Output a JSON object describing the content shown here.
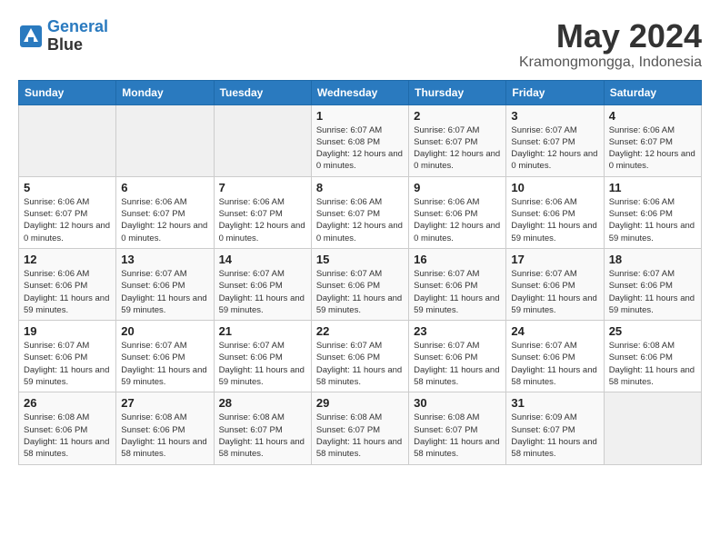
{
  "logo": {
    "line1": "General",
    "line2": "Blue"
  },
  "title": "May 2024",
  "location": "Kramongmongga, Indonesia",
  "days_of_week": [
    "Sunday",
    "Monday",
    "Tuesday",
    "Wednesday",
    "Thursday",
    "Friday",
    "Saturday"
  ],
  "weeks": [
    [
      {
        "day": "",
        "empty": true
      },
      {
        "day": "",
        "empty": true
      },
      {
        "day": "",
        "empty": true
      },
      {
        "day": "1",
        "sunrise": "6:07 AM",
        "sunset": "6:08 PM",
        "daylight": "12 hours and 0 minutes."
      },
      {
        "day": "2",
        "sunrise": "6:07 AM",
        "sunset": "6:07 PM",
        "daylight": "12 hours and 0 minutes."
      },
      {
        "day": "3",
        "sunrise": "6:07 AM",
        "sunset": "6:07 PM",
        "daylight": "12 hours and 0 minutes."
      },
      {
        "day": "4",
        "sunrise": "6:06 AM",
        "sunset": "6:07 PM",
        "daylight": "12 hours and 0 minutes."
      }
    ],
    [
      {
        "day": "5",
        "sunrise": "6:06 AM",
        "sunset": "6:07 PM",
        "daylight": "12 hours and 0 minutes."
      },
      {
        "day": "6",
        "sunrise": "6:06 AM",
        "sunset": "6:07 PM",
        "daylight": "12 hours and 0 minutes."
      },
      {
        "day": "7",
        "sunrise": "6:06 AM",
        "sunset": "6:07 PM",
        "daylight": "12 hours and 0 minutes."
      },
      {
        "day": "8",
        "sunrise": "6:06 AM",
        "sunset": "6:07 PM",
        "daylight": "12 hours and 0 minutes."
      },
      {
        "day": "9",
        "sunrise": "6:06 AM",
        "sunset": "6:06 PM",
        "daylight": "12 hours and 0 minutes."
      },
      {
        "day": "10",
        "sunrise": "6:06 AM",
        "sunset": "6:06 PM",
        "daylight": "11 hours and 59 minutes."
      },
      {
        "day": "11",
        "sunrise": "6:06 AM",
        "sunset": "6:06 PM",
        "daylight": "11 hours and 59 minutes."
      }
    ],
    [
      {
        "day": "12",
        "sunrise": "6:06 AM",
        "sunset": "6:06 PM",
        "daylight": "11 hours and 59 minutes."
      },
      {
        "day": "13",
        "sunrise": "6:07 AM",
        "sunset": "6:06 PM",
        "daylight": "11 hours and 59 minutes."
      },
      {
        "day": "14",
        "sunrise": "6:07 AM",
        "sunset": "6:06 PM",
        "daylight": "11 hours and 59 minutes."
      },
      {
        "day": "15",
        "sunrise": "6:07 AM",
        "sunset": "6:06 PM",
        "daylight": "11 hours and 59 minutes."
      },
      {
        "day": "16",
        "sunrise": "6:07 AM",
        "sunset": "6:06 PM",
        "daylight": "11 hours and 59 minutes."
      },
      {
        "day": "17",
        "sunrise": "6:07 AM",
        "sunset": "6:06 PM",
        "daylight": "11 hours and 59 minutes."
      },
      {
        "day": "18",
        "sunrise": "6:07 AM",
        "sunset": "6:06 PM",
        "daylight": "11 hours and 59 minutes."
      }
    ],
    [
      {
        "day": "19",
        "sunrise": "6:07 AM",
        "sunset": "6:06 PM",
        "daylight": "11 hours and 59 minutes."
      },
      {
        "day": "20",
        "sunrise": "6:07 AM",
        "sunset": "6:06 PM",
        "daylight": "11 hours and 59 minutes."
      },
      {
        "day": "21",
        "sunrise": "6:07 AM",
        "sunset": "6:06 PM",
        "daylight": "11 hours and 59 minutes."
      },
      {
        "day": "22",
        "sunrise": "6:07 AM",
        "sunset": "6:06 PM",
        "daylight": "11 hours and 58 minutes."
      },
      {
        "day": "23",
        "sunrise": "6:07 AM",
        "sunset": "6:06 PM",
        "daylight": "11 hours and 58 minutes."
      },
      {
        "day": "24",
        "sunrise": "6:07 AM",
        "sunset": "6:06 PM",
        "daylight": "11 hours and 58 minutes."
      },
      {
        "day": "25",
        "sunrise": "6:08 AM",
        "sunset": "6:06 PM",
        "daylight": "11 hours and 58 minutes."
      }
    ],
    [
      {
        "day": "26",
        "sunrise": "6:08 AM",
        "sunset": "6:06 PM",
        "daylight": "11 hours and 58 minutes."
      },
      {
        "day": "27",
        "sunrise": "6:08 AM",
        "sunset": "6:06 PM",
        "daylight": "11 hours and 58 minutes."
      },
      {
        "day": "28",
        "sunrise": "6:08 AM",
        "sunset": "6:07 PM",
        "daylight": "11 hours and 58 minutes."
      },
      {
        "day": "29",
        "sunrise": "6:08 AM",
        "sunset": "6:07 PM",
        "daylight": "11 hours and 58 minutes."
      },
      {
        "day": "30",
        "sunrise": "6:08 AM",
        "sunset": "6:07 PM",
        "daylight": "11 hours and 58 minutes."
      },
      {
        "day": "31",
        "sunrise": "6:09 AM",
        "sunset": "6:07 PM",
        "daylight": "11 hours and 58 minutes."
      },
      {
        "day": "",
        "empty": true
      }
    ]
  ]
}
